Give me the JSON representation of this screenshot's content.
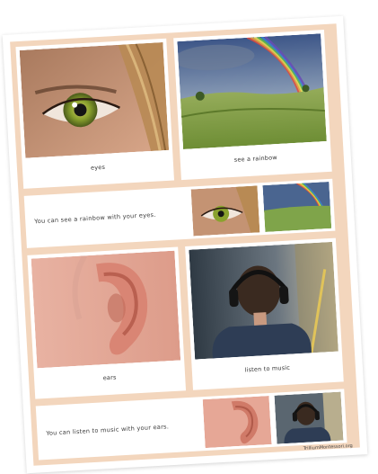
{
  "cards": {
    "eyes": {
      "label": "eyes"
    },
    "rainbow": {
      "label": "see a rainbow"
    },
    "sentence_1": {
      "text": "You can see a rainbow with your eyes."
    },
    "ears": {
      "label": "ears"
    },
    "music": {
      "label": "listen to music"
    },
    "sentence_2": {
      "text": "You can listen to music with your ears."
    }
  },
  "footer": {
    "credit": "TrilliumMontessori.org"
  },
  "colors": {
    "frame": "#f3d6bd",
    "card": "#ffffff",
    "sky": "#4a6590",
    "grass": "#7fa44a",
    "skin": "#e6a796",
    "iris": "#8aa22e"
  }
}
